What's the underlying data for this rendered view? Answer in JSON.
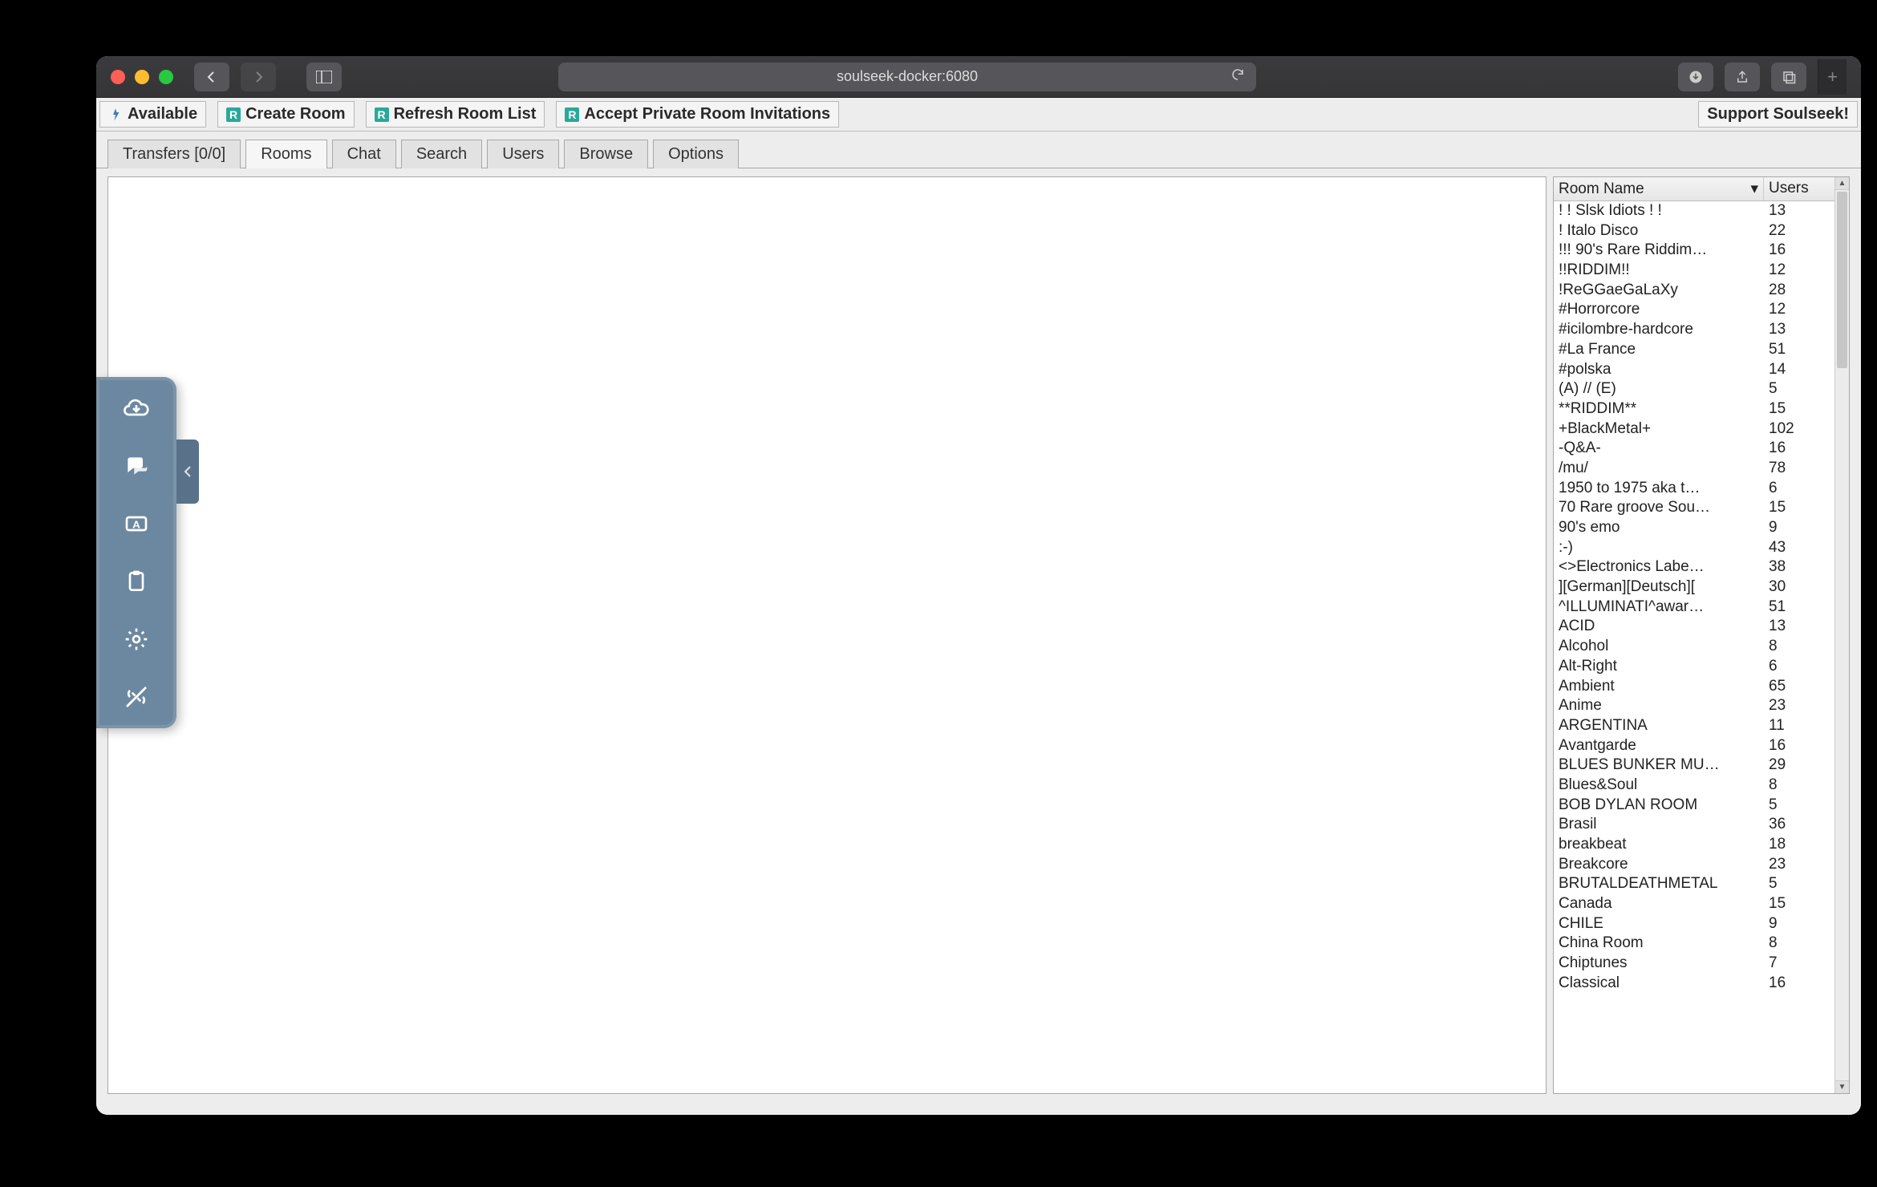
{
  "browser": {
    "url": "soulseek-docker:6080"
  },
  "toolbar": {
    "available": "Available",
    "create_room": "Create Room",
    "refresh": "Refresh Room List",
    "accept_invites": "Accept Private Room Invitations",
    "support": "Support Soulseek!"
  },
  "tabs": {
    "transfers": "Transfers [0/0]",
    "rooms": "Rooms",
    "chat": "Chat",
    "search": "Search",
    "users": "Users",
    "browse": "Browse",
    "options": "Options",
    "active": "rooms"
  },
  "room_table": {
    "headers": {
      "name": "Room Name",
      "users": "Users"
    },
    "rows": [
      {
        "name": "! ! Slsk Idiots ! !",
        "users": "13"
      },
      {
        "name": "! Italo Disco",
        "users": "22"
      },
      {
        "name": "!!! 90's Rare Riddim…",
        "users": "16"
      },
      {
        "name": "!!RIDDIM!!",
        "users": "12"
      },
      {
        "name": "!ReGGaeGaLaXy",
        "users": "28"
      },
      {
        "name": "#Horrorcore",
        "users": "12"
      },
      {
        "name": "#icilombre-hardcore",
        "users": "13"
      },
      {
        "name": "#La France",
        "users": "51"
      },
      {
        "name": "#polska",
        "users": "14"
      },
      {
        "name": "(A) // (E)",
        "users": "5"
      },
      {
        "name": "**RIDDIM**",
        "users": "15"
      },
      {
        "name": "+BlackMetal+",
        "users": "102"
      },
      {
        "name": "-Q&A-",
        "users": "16"
      },
      {
        "name": "/mu/",
        "users": "78"
      },
      {
        "name": "1950 to 1975 aka t…",
        "users": "6"
      },
      {
        "name": "70 Rare groove Sou…",
        "users": "15"
      },
      {
        "name": "90's emo",
        "users": "9"
      },
      {
        "name": ":-)",
        "users": "43"
      },
      {
        "name": "<>Electronics Labe…",
        "users": "38"
      },
      {
        "name": "][German][Deutsch][",
        "users": "30"
      },
      {
        "name": "^ILLUMINATI^awar…",
        "users": "51"
      },
      {
        "name": "ACID",
        "users": "13"
      },
      {
        "name": "Alcohol",
        "users": "8"
      },
      {
        "name": "Alt-Right",
        "users": "6"
      },
      {
        "name": "Ambient",
        "users": "65"
      },
      {
        "name": "Anime",
        "users": "23"
      },
      {
        "name": "ARGENTINA",
        "users": "11"
      },
      {
        "name": "Avantgarde",
        "users": "16"
      },
      {
        "name": "BLUES BUNKER MU…",
        "users": "29"
      },
      {
        "name": "Blues&Soul",
        "users": "8"
      },
      {
        "name": "BOB DYLAN ROOM",
        "users": "5"
      },
      {
        "name": "Brasil",
        "users": "36"
      },
      {
        "name": "breakbeat",
        "users": "18"
      },
      {
        "name": "Breakcore",
        "users": "23"
      },
      {
        "name": "BRUTALDEATHMETAL",
        "users": "5"
      },
      {
        "name": "Canada",
        "users": "15"
      },
      {
        "name": "CHILE",
        "users": "9"
      },
      {
        "name": "China Room",
        "users": "8"
      },
      {
        "name": "Chiptunes",
        "users": "7"
      },
      {
        "name": "Classical",
        "users": "16"
      }
    ]
  }
}
